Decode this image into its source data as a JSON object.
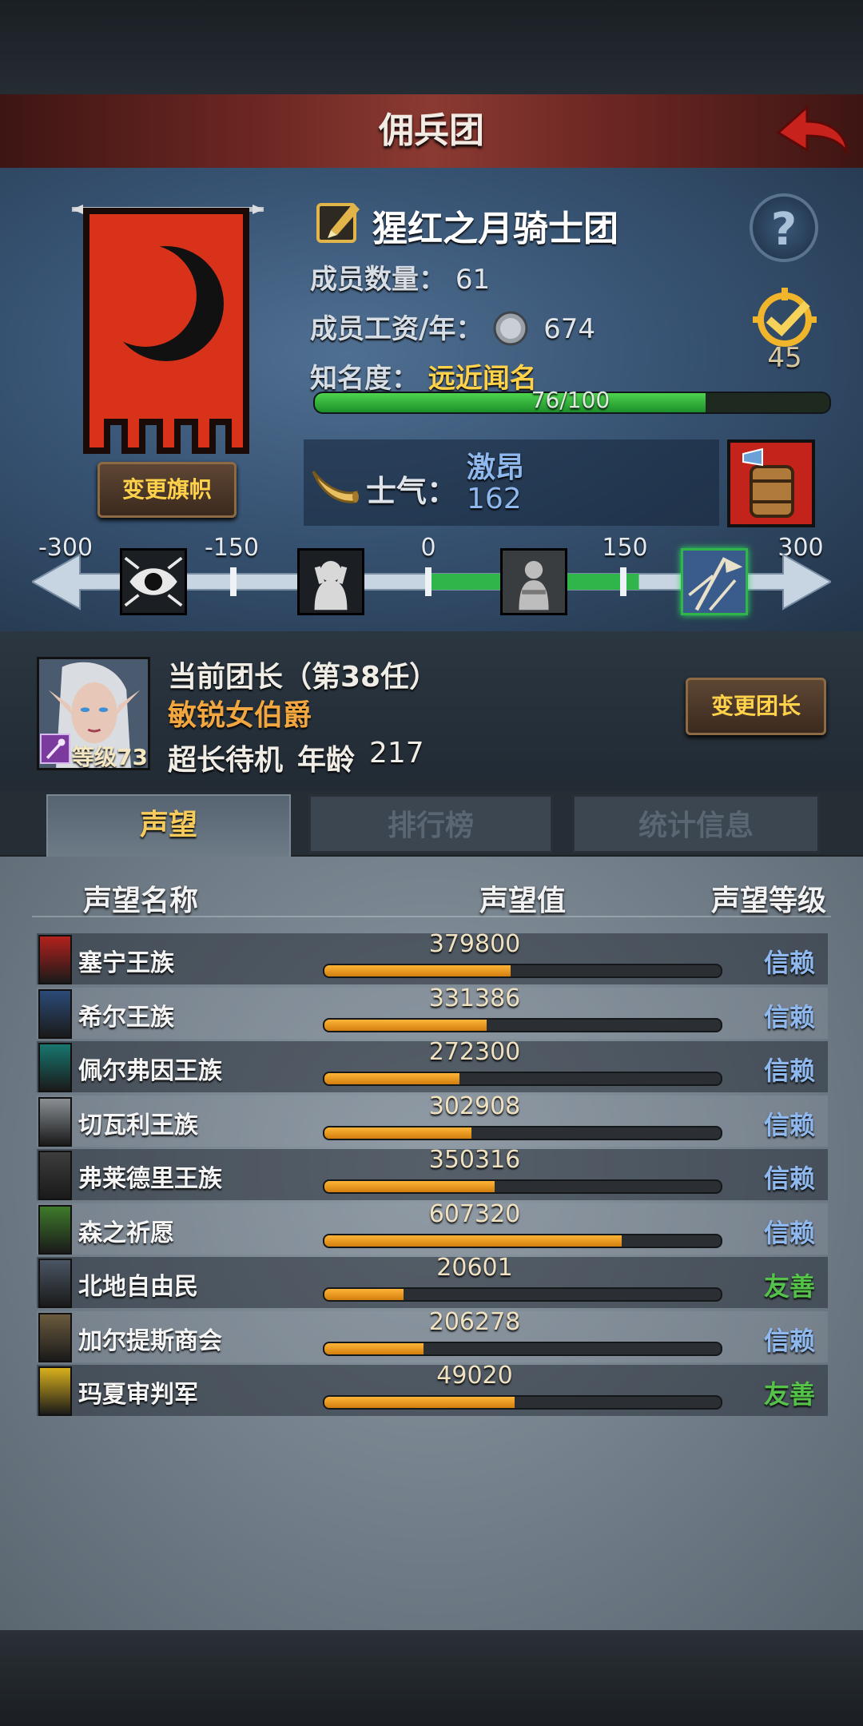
{
  "header": {
    "title": "佣兵团"
  },
  "guild": {
    "name": "猩红之月骑士团",
    "members_label": "成员数量：",
    "members": "61",
    "salary_label": "成员工资/年：",
    "salary": "674",
    "fame_label": "知名度：",
    "fame": "远近闻名",
    "fame_progress_text": "76/100",
    "fame_progress": 0.76,
    "achievement_count": "45",
    "change_flag_label": "变更旗帜",
    "help_label": "?"
  },
  "morale": {
    "label": "士气：",
    "state": "激昂",
    "value": "162",
    "scale_ticks": [
      "-300",
      "-150",
      "0",
      "150",
      "300"
    ],
    "scale_value": 162,
    "scale_range": [
      -300,
      300
    ]
  },
  "commander": {
    "title": "当前团长（第38任）",
    "name": "敏锐女伯爵",
    "level_label": "等级73",
    "status": "超长待机",
    "age_label": "年龄",
    "age": "217",
    "change_label": "变更团长"
  },
  "tabs": [
    {
      "label": "声望",
      "active": true
    },
    {
      "label": "排行榜",
      "active": false
    },
    {
      "label": "统计信息",
      "active": false
    }
  ],
  "table": {
    "headers": {
      "name": "声望名称",
      "value": "声望值",
      "level": "声望等级"
    },
    "rows": [
      {
        "name": "塞宁王族",
        "value": "379800",
        "progress": 0.47,
        "level": "信赖",
        "level_color": "#8fb9ee",
        "crest_color": "#b3211c",
        "crest_icon": "sword-crest-icon"
      },
      {
        "name": "希尔王族",
        "value": "331386",
        "progress": 0.41,
        "level": "信赖",
        "level_color": "#8fb9ee",
        "crest_color": "#2b4a77",
        "crest_icon": "helm-crest-icon"
      },
      {
        "name": "佩尔弗因王族",
        "value": "272300",
        "progress": 0.34,
        "level": "信赖",
        "level_color": "#8fb9ee",
        "crest_color": "#17766f",
        "crest_icon": "moon-crest-icon"
      },
      {
        "name": "切瓦利王族",
        "value": "302908",
        "progress": 0.37,
        "level": "信赖",
        "level_color": "#8fb9ee",
        "crest_color": "#8a8f94",
        "crest_icon": "scales-crest-icon"
      },
      {
        "name": "弗莱德里王族",
        "value": "350316",
        "progress": 0.43,
        "level": "信赖",
        "level_color": "#8fb9ee",
        "crest_color": "#3d3d3d",
        "crest_icon": "demon-crest-icon"
      },
      {
        "name": "森之祈愿",
        "value": "607320",
        "progress": 0.75,
        "level": "信赖",
        "level_color": "#8fb9ee",
        "crest_color": "#3e7a2a",
        "crest_icon": "tree-crest-icon"
      },
      {
        "name": "北地自由民",
        "value": "20601",
        "progress": 0.2,
        "level": "友善",
        "level_color": "#55c24a",
        "crest_color": "#4a5563",
        "crest_icon": "axe-crest-icon"
      },
      {
        "name": "加尔提斯商会",
        "value": "206278",
        "progress": 0.25,
        "level": "信赖",
        "level_color": "#8fb9ee",
        "crest_color": "#6b5a3d",
        "crest_icon": "chest-crest-icon"
      },
      {
        "name": "玛夏审判军",
        "value": "49020",
        "progress": 0.48,
        "level": "友善",
        "level_color": "#55c24a",
        "crest_color": "#d8b01c",
        "crest_icon": "sun-crest-icon"
      }
    ]
  }
}
